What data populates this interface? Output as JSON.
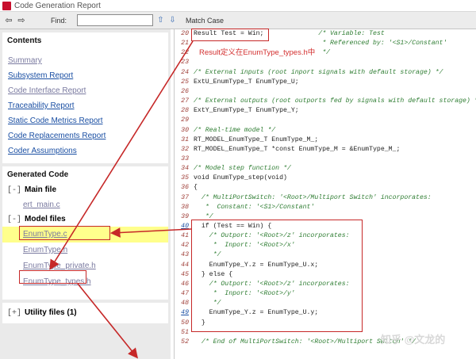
{
  "window": {
    "title": "Code Generation Report"
  },
  "toolbar": {
    "find_label": "Find:",
    "find_value": "",
    "match_case": "Match Case",
    "back_icon": "back-arrow-icon",
    "forward_icon": "forward-arrow-icon",
    "up_icon": "up-arrow-icon",
    "down_icon": "down-arrow-icon"
  },
  "contents": {
    "title": "Contents",
    "links": [
      "Summary",
      "Subsystem Report",
      "Code Interface Report",
      "Traceability Report",
      "Static Code Metrics Report",
      "Code Replacements Report",
      "Coder Assumptions"
    ]
  },
  "generated": {
    "title": "Generated Code",
    "main_group": {
      "toggle": "[-]",
      "label": "Main file",
      "files": [
        "ert_main.c"
      ]
    },
    "model_group": {
      "toggle": "[-]",
      "label": "Model files",
      "files": [
        "EnumType.c",
        "EnumType.h",
        "EnumType_private.h",
        "EnumType_types.h"
      ]
    },
    "utility_group": {
      "toggle": "[+]",
      "label": "Utility files (1)"
    }
  },
  "annotation": "Result定义在EnumType_types.h中",
  "watermark": "知乎 @文龙的",
  "code_lines": [
    {
      "n": "20",
      "code": "Result Test = Win;",
      "comment": "/* Variable: Test"
    },
    {
      "n": "21",
      "code": "",
      "comment": " * Referenced by: '<S1>/Constant'"
    },
    {
      "n": "22",
      "code": "",
      "comment": " */"
    },
    {
      "n": "23",
      "code": "",
      "comment": ""
    },
    {
      "n": "24",
      "code": "",
      "comment": "/* External inputs (root inport signals with default storage) */"
    },
    {
      "n": "25",
      "code": "ExtU_EnumType_T EnumType_U;",
      "comment": ""
    },
    {
      "n": "26",
      "code": "",
      "comment": ""
    },
    {
      "n": "27",
      "code": "",
      "comment": "/* External outputs (root outports fed by signals with default storage) */"
    },
    {
      "n": "28",
      "code": "ExtY_EnumType_T EnumType_Y;",
      "comment": ""
    },
    {
      "n": "29",
      "code": "",
      "comment": ""
    },
    {
      "n": "30",
      "code": "",
      "comment": "/* Real-time model */"
    },
    {
      "n": "31",
      "code": "RT_MODEL_EnumType_T EnumType_M_;",
      "comment": ""
    },
    {
      "n": "32",
      "code": "RT_MODEL_EnumType_T *const EnumType_M = &EnumType_M_;",
      "comment": ""
    },
    {
      "n": "33",
      "code": "",
      "comment": ""
    },
    {
      "n": "34",
      "code": "",
      "comment": "/* Model step function */"
    },
    {
      "n": "35",
      "code": "void EnumType_step(void)",
      "comment": ""
    },
    {
      "n": "36",
      "code": "{",
      "comment": ""
    },
    {
      "n": "37",
      "code": "  ",
      "comment": "/* MultiPortSwitch: '<Root>/Multiport Switch' incorporates:"
    },
    {
      "n": "38",
      "code": "  ",
      "comment": " *  Constant: '<S1>/Constant'"
    },
    {
      "n": "39",
      "code": "  ",
      "comment": " */"
    },
    {
      "n": "40",
      "code": "  if (Test == Win) {",
      "comment": "",
      "link": true
    },
    {
      "n": "41",
      "code": "    ",
      "comment": "/* Outport: '<Root>/z' incorporates:"
    },
    {
      "n": "42",
      "code": "    ",
      "comment": " *  Inport: '<Root>/x'"
    },
    {
      "n": "43",
      "code": "    ",
      "comment": " */"
    },
    {
      "n": "44",
      "code": "    EnumType_Y.z = EnumType_U.x;",
      "comment": ""
    },
    {
      "n": "45",
      "code": "  } else {",
      "comment": ""
    },
    {
      "n": "46",
      "code": "    ",
      "comment": "/* Outport: '<Root>/z' incorporates:"
    },
    {
      "n": "47",
      "code": "    ",
      "comment": " *  Inport: '<Root>/y'"
    },
    {
      "n": "48",
      "code": "    ",
      "comment": " */"
    },
    {
      "n": "49",
      "code": "    EnumType_Y.z = EnumType_U.y;",
      "comment": "",
      "link": true
    },
    {
      "n": "50",
      "code": "  }",
      "comment": ""
    },
    {
      "n": "51",
      "code": "",
      "comment": ""
    },
    {
      "n": "52",
      "code": "  ",
      "comment": "/* End of MultiPortSwitch: '<Root>/Multiport Switch' */"
    }
  ],
  "colors": {
    "annotation_red": "#c62828",
    "highlight_yellow": "#ffff8c",
    "link_blue": "#1a4fa3"
  }
}
